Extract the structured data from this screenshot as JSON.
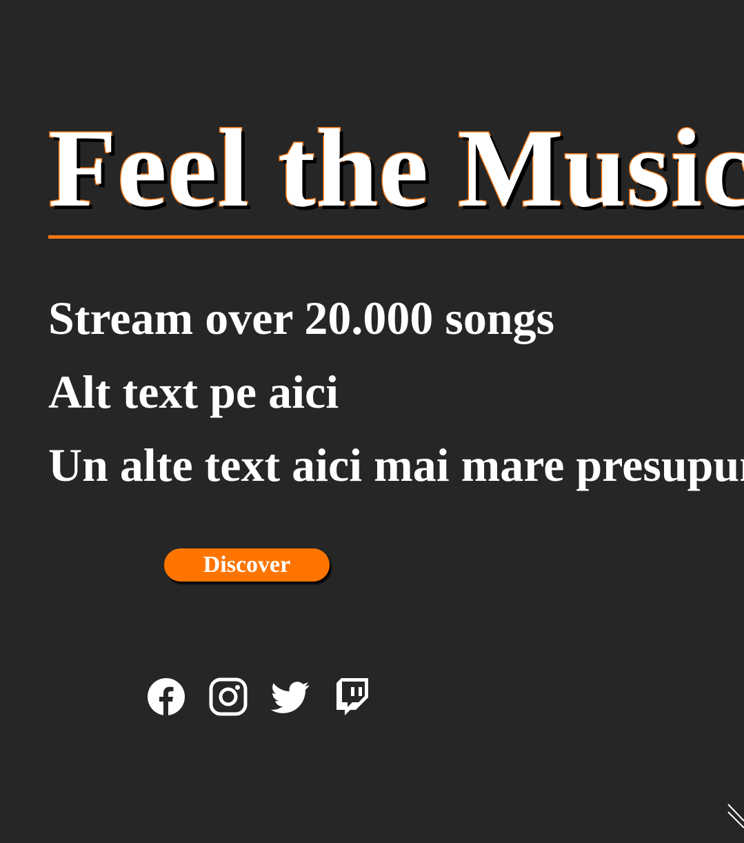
{
  "hero": {
    "title": "Feel the Music",
    "lines": [
      "Stream over 20.000 songs",
      "Alt text pe aici",
      "Un alte text aici mai mare presupun"
    ]
  },
  "cta": {
    "discover_label": "Discover"
  },
  "social": [
    {
      "icon": "facebook-icon"
    },
    {
      "icon": "instagram-icon"
    },
    {
      "icon": "twitter-icon"
    },
    {
      "icon": "twitch-icon"
    }
  ],
  "colors": {
    "background": "#262626",
    "accent": "#f57714",
    "button": "#fd7500",
    "text": "#ffffff"
  }
}
